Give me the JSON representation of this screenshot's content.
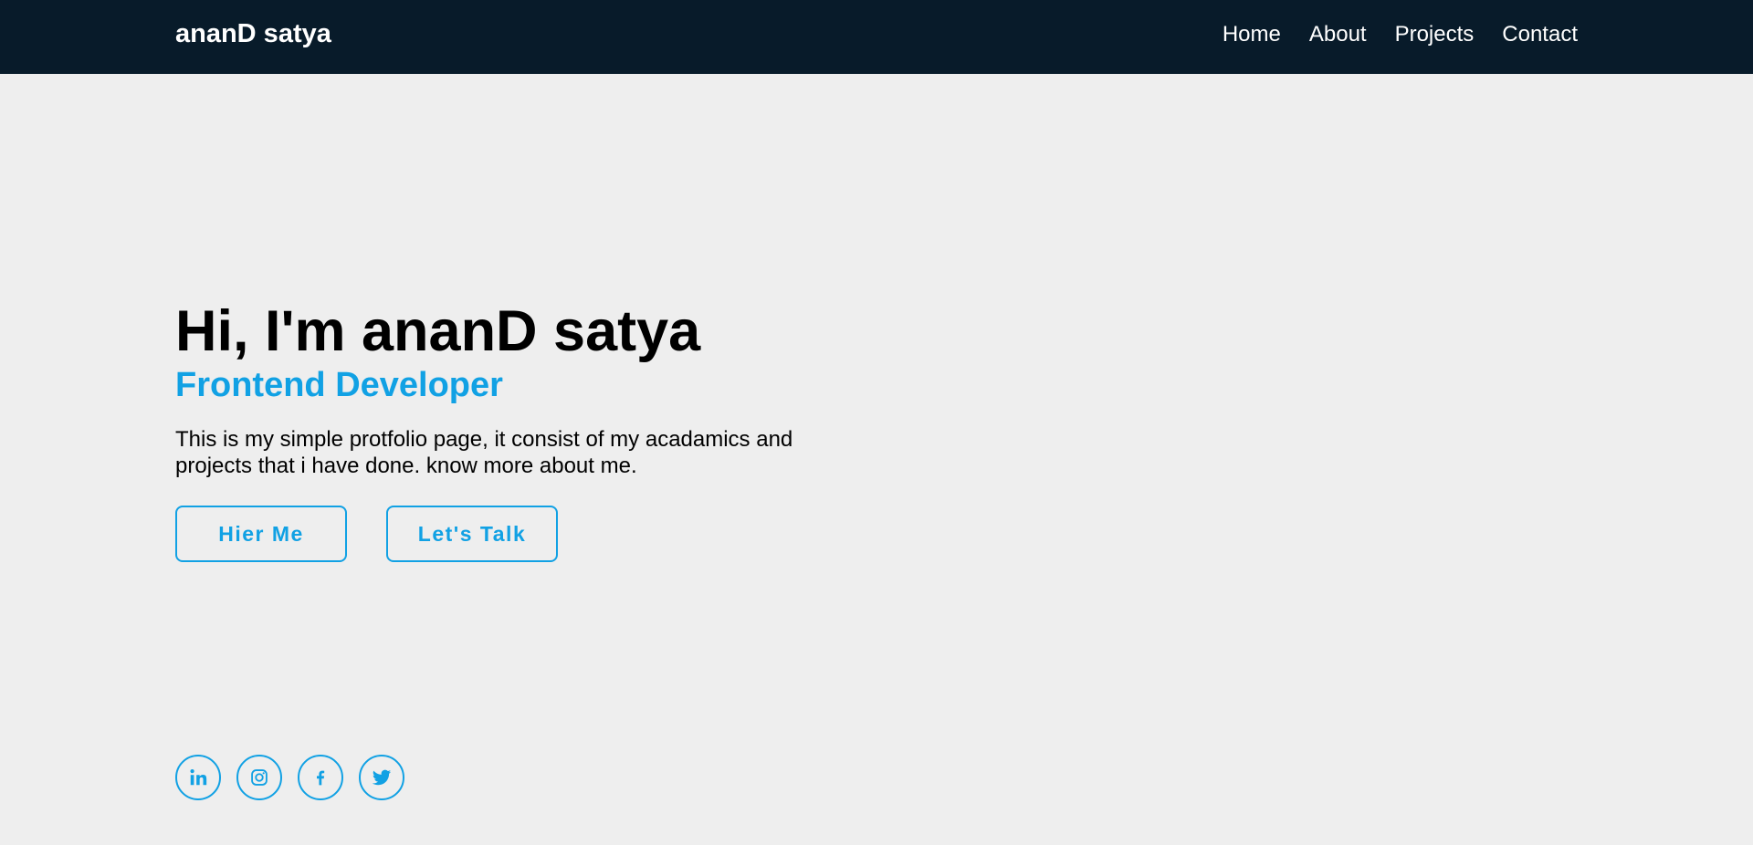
{
  "header": {
    "brand": "ananD satya",
    "nav": [
      {
        "label": "Home"
      },
      {
        "label": "About"
      },
      {
        "label": "Projects"
      },
      {
        "label": "Contact"
      }
    ]
  },
  "hero": {
    "title": "Hi, I'm ananD satya",
    "subtitle": "Frontend Developer",
    "description": "This is my simple protfolio page, it consist of my acadamics and projects that i have done. know more about me.",
    "buttons": [
      {
        "label": "Hier Me"
      },
      {
        "label": "Let's Talk"
      }
    ]
  },
  "socials": [
    {
      "icon": "linkedin-icon"
    },
    {
      "icon": "instagram-icon"
    },
    {
      "icon": "facebook-icon"
    },
    {
      "icon": "twitter-icon"
    }
  ],
  "colors": {
    "navbar_bg": "#081b2a",
    "page_bg": "#eeeeee",
    "accent": "#11a1e4",
    "text": "#000000"
  }
}
